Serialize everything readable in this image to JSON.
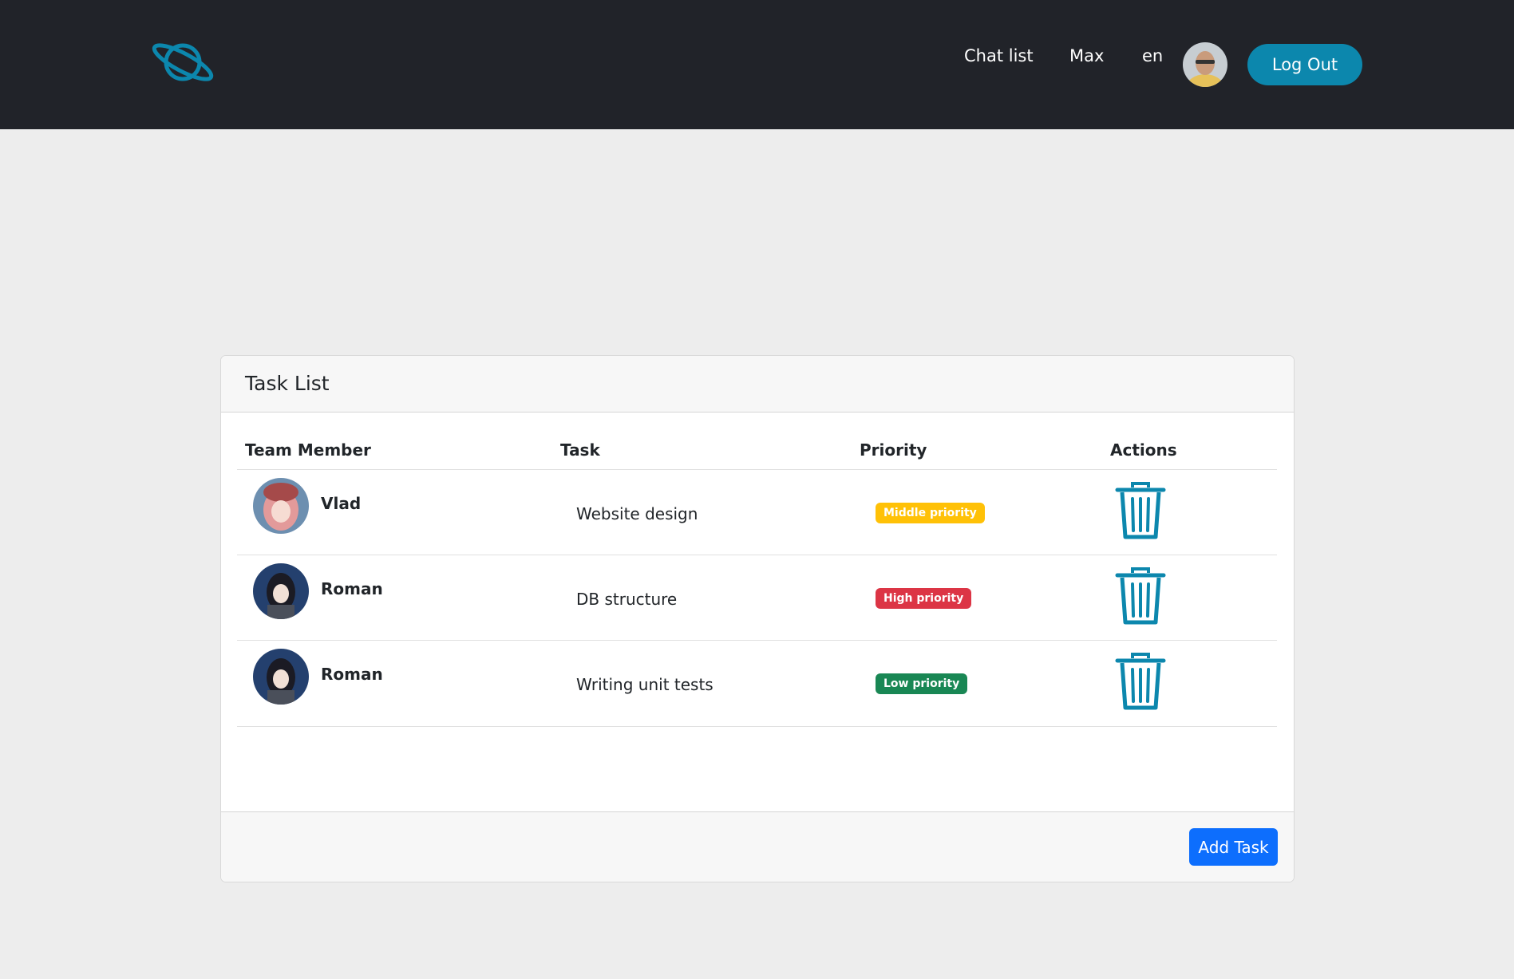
{
  "colors": {
    "navbar_bg": "#212329",
    "accent": "#0c87ad",
    "primary_button": "#0d6efd",
    "page_bg": "#ededed"
  },
  "nav": {
    "logo_icon": "planet-icon",
    "links": [
      "Chat list",
      "Max",
      "en"
    ],
    "avatar_icon": "user-avatar",
    "logout_label": "Log Out"
  },
  "card": {
    "title": "Task List",
    "columns": [
      "Team Member",
      "Task",
      "Priority",
      "Actions"
    ],
    "rows": [
      {
        "member": "Vlad",
        "task": "Website design",
        "priority": "Middle priority",
        "priority_color": "#ffc107",
        "delete_icon": "trash-icon"
      },
      {
        "member": "Roman",
        "task": "DB structure",
        "priority": "High priority",
        "priority_color": "#dc3545",
        "delete_icon": "trash-icon"
      },
      {
        "member": "Roman",
        "task": "Writing unit tests",
        "priority": "Low priority",
        "priority_color": "#198754",
        "delete_icon": "trash-icon"
      }
    ],
    "add_button": "Add Task"
  }
}
